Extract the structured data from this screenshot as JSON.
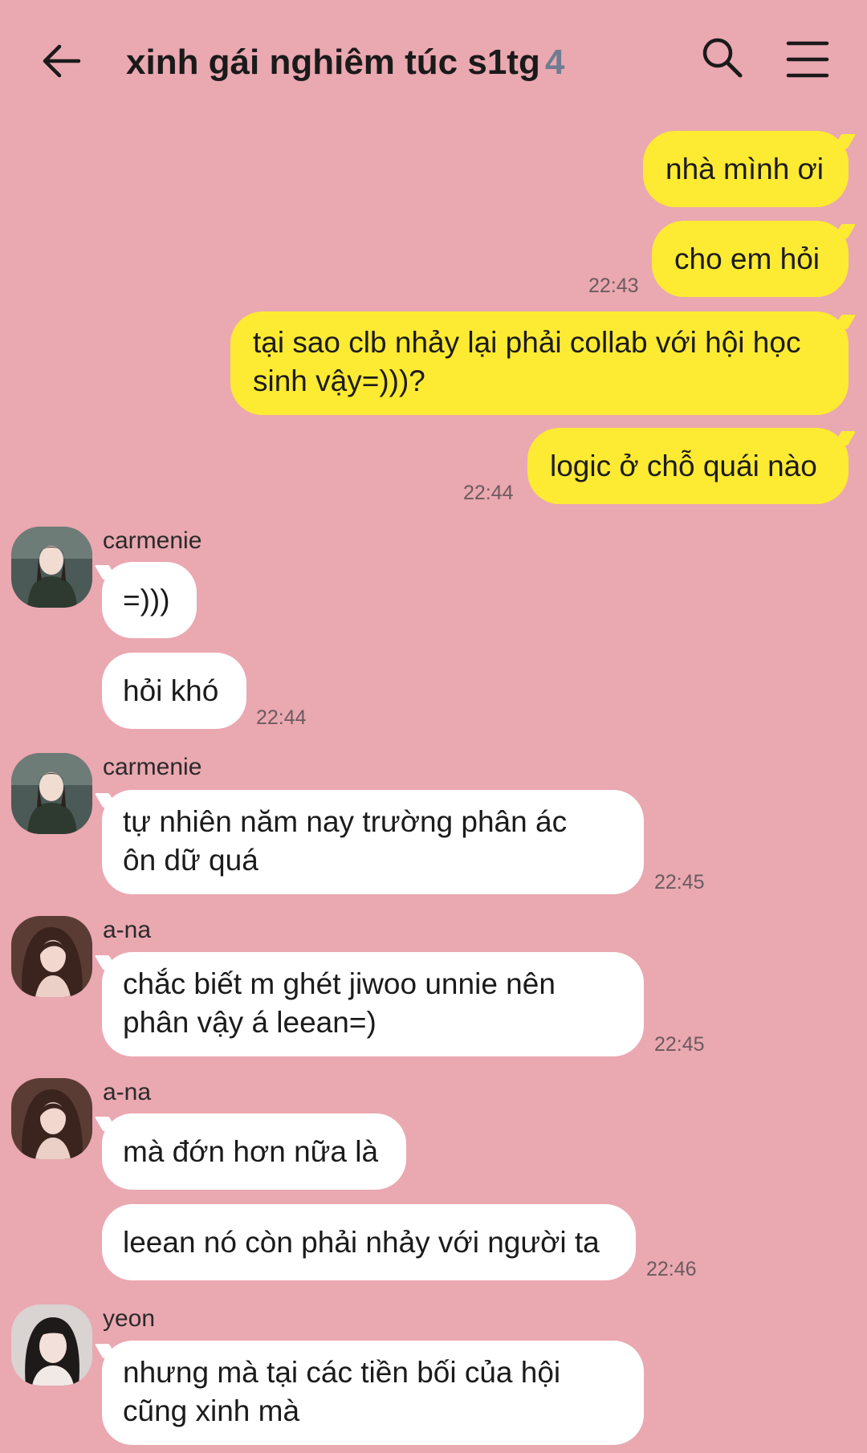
{
  "header": {
    "title": "xinh gái nghiêm túc s1tg",
    "member_count": "4",
    "icons": {
      "back": "back-arrow-icon",
      "search": "search-icon",
      "menu": "hamburger-menu-icon"
    }
  },
  "colors": {
    "background": "#eaa8b0",
    "my_bubble": "#fdea33",
    "their_bubble": "#ffffff",
    "member_count": "#6f7c91"
  },
  "messages": [
    {
      "from": "me",
      "text": "nhà mình ơi"
    },
    {
      "from": "me",
      "text": "cho em hỏi",
      "time": "22:43"
    },
    {
      "from": "me",
      "lines": [
        "tại sao clb nhảy lại phải collab với hội học",
        "sinh vậy=)))?"
      ]
    },
    {
      "from": "me",
      "text": "logic ở chỗ quái nào",
      "time": "22:44"
    },
    {
      "from": "carmenie",
      "sender": "carmenie",
      "text": "=)))"
    },
    {
      "from": "carmenie",
      "text": "hỏi khó",
      "time": "22:44"
    },
    {
      "from": "carmenie",
      "sender": "carmenie",
      "lines": [
        "tự nhiên năm nay trường phân ác",
        "ôn dữ quá"
      ],
      "time": "22:45"
    },
    {
      "from": "a-na",
      "sender": "a-na",
      "lines": [
        "chắc biết m ghét jiwoo unnie nên",
        "phân vậy á leean=)"
      ],
      "time": "22:45"
    },
    {
      "from": "a-na",
      "sender": "a-na",
      "text": "mà đớn hơn nữa là"
    },
    {
      "from": "a-na",
      "text": "leean nó còn phải nhảy với người ta",
      "time": "22:46"
    },
    {
      "from": "yeon",
      "sender": "yeon",
      "lines": [
        "nhưng mà tại các tiền bối của hội",
        "cũng xinh mà"
      ]
    }
  ]
}
